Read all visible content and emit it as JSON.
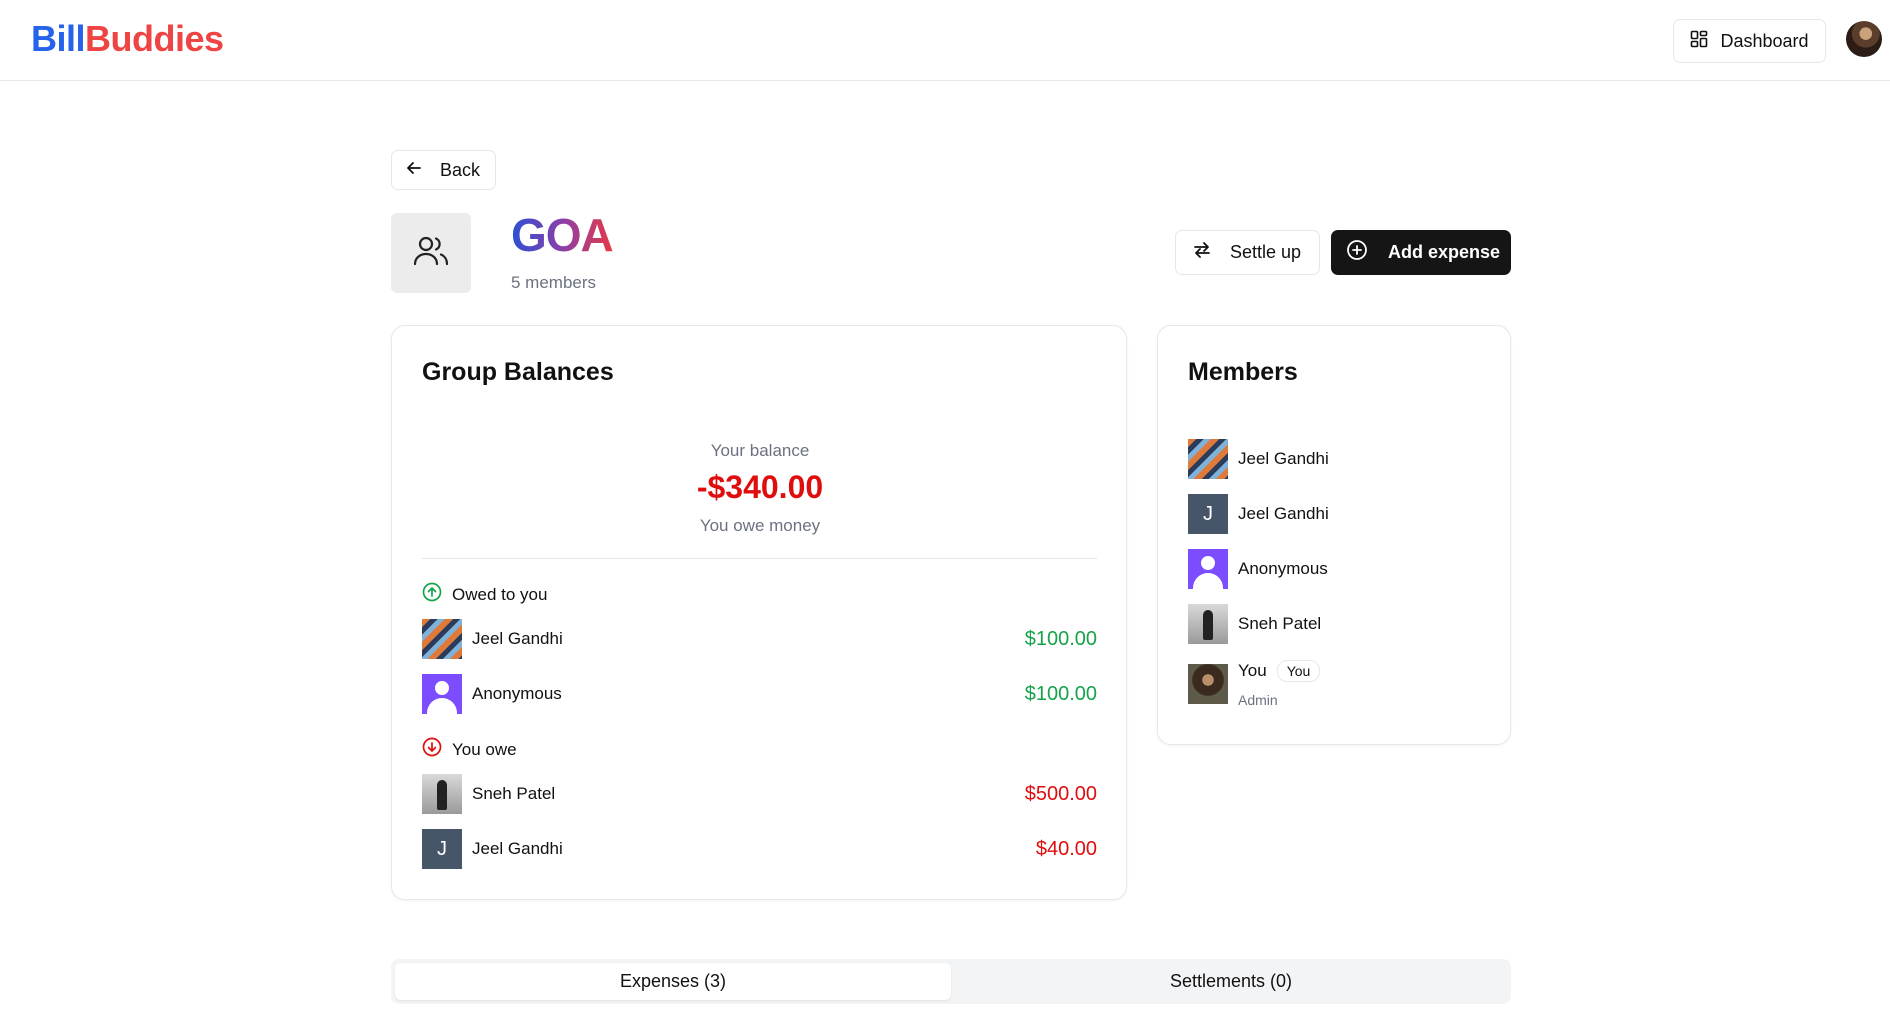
{
  "header": {
    "logo_part1": "Bill",
    "logo_part2": "Buddies",
    "dashboard_label": "Dashboard",
    "dashboard_icon": "grid-icon",
    "avatar_icon": "user-avatar"
  },
  "nav": {
    "back_label": "Back",
    "back_icon": "arrow-left-icon"
  },
  "group": {
    "name": "GOA",
    "members_count": "5 members",
    "icon": "users-icon",
    "settle_label": "Settle up",
    "settle_icon": "arrows-exchange-icon",
    "add_label": "Add expense",
    "add_icon": "plus-circle-icon"
  },
  "balances": {
    "title": "Group Balances",
    "your_balance_label": "Your balance",
    "your_balance_amount": "-$340.00",
    "your_balance_note": "You owe money",
    "owed_header": "Owed to you",
    "owed": [
      {
        "name": "Jeel Gandhi",
        "amount": "$100.00"
      },
      {
        "name": "Anonymous",
        "amount": "$100.00"
      }
    ],
    "owe_header": "You owe",
    "owe": [
      {
        "name": "Sneh Patel",
        "amount": "$500.00"
      },
      {
        "name": "Jeel Gandhi",
        "amount": "$40.00",
        "initial": "J"
      }
    ]
  },
  "members": {
    "title": "Members",
    "list": [
      {
        "name": "Jeel Gandhi"
      },
      {
        "name": "Jeel Gandhi",
        "initial": "J"
      },
      {
        "name": "Anonymous"
      },
      {
        "name": "Sneh Patel"
      },
      {
        "name": "You",
        "badge": "You",
        "role": "Admin"
      }
    ]
  },
  "tabs": [
    {
      "label": "Expenses (3)",
      "active": true
    },
    {
      "label": "Settlements (0)",
      "active": false
    }
  ],
  "colors": {
    "positive": "#16a34a",
    "negative": "#e00d0d",
    "primary_button": "#151515",
    "logo_blue": "#2563eb",
    "logo_red": "#ef4444"
  }
}
